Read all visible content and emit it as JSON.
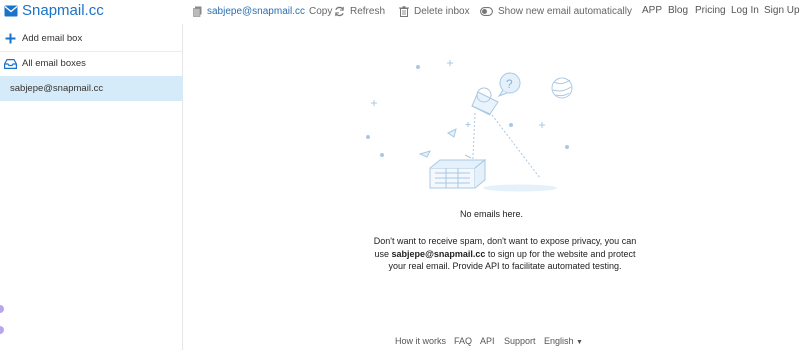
{
  "brand": {
    "name": "Snapmail.cc"
  },
  "toolbar": {
    "email": "sabjepe@snapmail.cc",
    "copy_label": "Copy",
    "refresh_label": "Refresh",
    "delete_label": "Delete inbox",
    "show_new_label": "Show new email automatically"
  },
  "nav": {
    "app": "APP",
    "blog": "Blog",
    "pricing": "Pricing",
    "login": "Log In",
    "signup": "Sign Up"
  },
  "sidebar": {
    "add_label": "Add email box",
    "all_label": "All email boxes",
    "selected_email": "sabjepe@snapmail.cc"
  },
  "main": {
    "empty_message": "No emails here.",
    "desc_part1": "Don't want to receive spam, don't want to expose privacy, you can use ",
    "desc_email": "sabjepe@snapmail.cc",
    "desc_part2": " to sign up for the website and protect your real email. Provide API to facilitate automated testing."
  },
  "footer": {
    "how": "How it works",
    "faq": "FAQ",
    "api": "API",
    "support": "Support",
    "lang": "English"
  },
  "colors": {
    "accent": "#1a73c8",
    "selected_bg": "#d6ebf9",
    "illustration": "#aac8e4"
  }
}
